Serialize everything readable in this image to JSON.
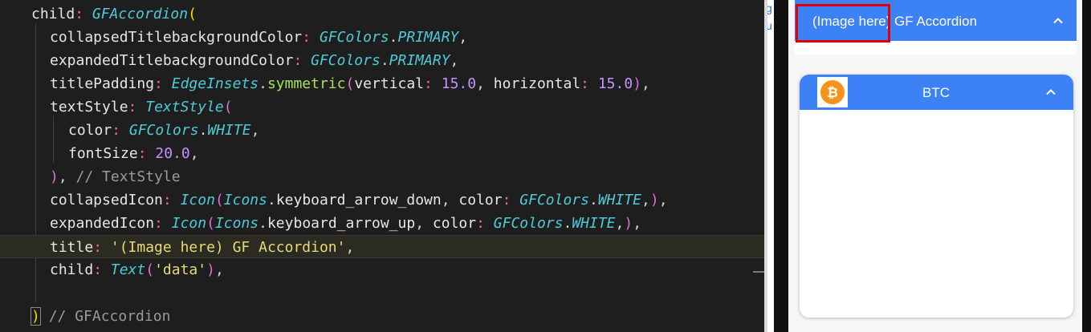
{
  "editor": {
    "lines": [
      [
        [
          "child",
          "c-id"
        ],
        [
          ": ",
          "c-colon"
        ],
        [
          "GFAccordion",
          "c-class"
        ],
        [
          "(",
          "c-brace"
        ]
      ],
      [
        [
          "collapsedTitlebackgroundColor",
          "c-id"
        ],
        [
          ": ",
          "c-colon"
        ],
        [
          "GFColors",
          "c-const"
        ],
        [
          ".",
          "c-punc"
        ],
        [
          "PRIMARY",
          "c-const"
        ],
        [
          ",",
          "c-punc"
        ]
      ],
      [
        [
          "expandedTitlebackgroundColor",
          "c-id"
        ],
        [
          ": ",
          "c-colon"
        ],
        [
          "GFColors",
          "c-const"
        ],
        [
          ".",
          "c-punc"
        ],
        [
          "PRIMARY",
          "c-const"
        ],
        [
          ",",
          "c-punc"
        ]
      ],
      [
        [
          "titlePadding",
          "c-id"
        ],
        [
          ": ",
          "c-colon"
        ],
        [
          "EdgeInsets",
          "c-class"
        ],
        [
          ".",
          "c-punc"
        ],
        [
          "symmetric",
          "c-fn"
        ],
        [
          "(",
          "c-brace2"
        ],
        [
          "vertical",
          "c-id"
        ],
        [
          ": ",
          "c-colon"
        ],
        [
          "15.0",
          "c-num"
        ],
        [
          ", ",
          "c-punc"
        ],
        [
          "horizontal",
          "c-id"
        ],
        [
          ": ",
          "c-colon"
        ],
        [
          "15.0",
          "c-num"
        ],
        [
          ")",
          "c-brace2"
        ],
        [
          ",",
          "c-punc"
        ]
      ],
      [
        [
          "textStyle",
          "c-id"
        ],
        [
          ": ",
          "c-colon"
        ],
        [
          "TextStyle",
          "c-class"
        ],
        [
          "(",
          "c-brace2"
        ]
      ],
      [
        [
          "color",
          "c-id"
        ],
        [
          ": ",
          "c-colon"
        ],
        [
          "GFColors",
          "c-const"
        ],
        [
          ".",
          "c-punc"
        ],
        [
          "WHITE",
          "c-const"
        ],
        [
          ",",
          "c-punc"
        ]
      ],
      [
        [
          "fontSize",
          "c-id"
        ],
        [
          ": ",
          "c-colon"
        ],
        [
          "20.0",
          "c-num"
        ],
        [
          ",",
          "c-punc"
        ]
      ],
      [
        [
          ")",
          "c-brace2"
        ],
        [
          ", ",
          "c-punc"
        ],
        [
          "// TextStyle",
          "c-comment"
        ]
      ],
      [
        [
          "collapsedIcon",
          "c-id"
        ],
        [
          ": ",
          "c-colon"
        ],
        [
          "Icon",
          "c-class"
        ],
        [
          "(",
          "c-brace2"
        ],
        [
          "Icons",
          "c-const"
        ],
        [
          ".",
          "c-punc"
        ],
        [
          "keyboard_arrow_down",
          "c-id"
        ],
        [
          ", ",
          "c-punc"
        ],
        [
          "color",
          "c-id"
        ],
        [
          ": ",
          "c-colon"
        ],
        [
          "GFColors",
          "c-const"
        ],
        [
          ".",
          "c-punc"
        ],
        [
          "WHITE",
          "c-const"
        ],
        [
          ",",
          "c-punc"
        ],
        [
          ")",
          "c-brace2"
        ],
        [
          ",",
          "c-punc"
        ]
      ],
      [
        [
          "expandedIcon",
          "c-id"
        ],
        [
          ": ",
          "c-colon"
        ],
        [
          "Icon",
          "c-class"
        ],
        [
          "(",
          "c-brace2"
        ],
        [
          "Icons",
          "c-const"
        ],
        [
          ".",
          "c-punc"
        ],
        [
          "keyboard_arrow_up",
          "c-id"
        ],
        [
          ", ",
          "c-punc"
        ],
        [
          "color",
          "c-id"
        ],
        [
          ": ",
          "c-colon"
        ],
        [
          "GFColors",
          "c-const"
        ],
        [
          ".",
          "c-punc"
        ],
        [
          "WHITE",
          "c-const"
        ],
        [
          ",",
          "c-punc"
        ],
        [
          ")",
          "c-brace2"
        ],
        [
          ",",
          "c-punc"
        ]
      ],
      [
        [
          "title",
          "c-id"
        ],
        [
          ": ",
          "c-colon"
        ],
        [
          "'(Image here) GF Accordion'",
          "c-str"
        ],
        [
          ",",
          "c-punc"
        ]
      ],
      [
        [
          "child",
          "c-id"
        ],
        [
          ": ",
          "c-colon"
        ],
        [
          "Text",
          "c-class"
        ],
        [
          "(",
          "c-brace2"
        ],
        [
          "'data'",
          "c-str"
        ],
        [
          ")",
          "c-brace2"
        ],
        [
          ",",
          "c-punc"
        ]
      ],
      [],
      [
        [
          ")",
          "c-brace"
        ],
        [
          " ",
          "c-punc"
        ],
        [
          "// GFAccordion",
          "c-comment"
        ]
      ]
    ]
  },
  "browser_strip": {
    "chars": [
      "g",
      "u"
    ]
  },
  "preview": {
    "accordion_1": {
      "title": "(Image here) GF Accordion",
      "icon": "keyboard-arrow-up-icon"
    },
    "accordion_2": {
      "title": "BTC",
      "image": "bitcoin-icon",
      "icon": "keyboard-arrow-up-icon"
    }
  },
  "colors": {
    "primary": "#3c82f6",
    "highlight": "#e00000",
    "bitcoin": "#f7931a",
    "editor_bg": "#1e1e1e"
  }
}
